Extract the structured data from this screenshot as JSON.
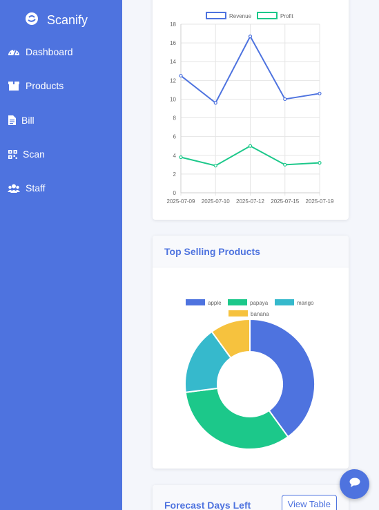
{
  "app": {
    "brand": "Scanify"
  },
  "sidebar": {
    "items": [
      {
        "label": "Dashboard",
        "icon": "gauge-icon"
      },
      {
        "label": "Products",
        "icon": "box-icon"
      },
      {
        "label": "Bill",
        "icon": "file-icon"
      },
      {
        "label": "Scan",
        "icon": "qr-icon"
      },
      {
        "label": "Staff",
        "icon": "users-icon"
      }
    ]
  },
  "colors": {
    "primary": "#4e73df",
    "revenue": "#4e73df",
    "profit": "#1cc88a",
    "mango": "#36b9cc",
    "banana": "#f6c23e"
  },
  "cards": {
    "top_selling": {
      "title": "Top Selling Products"
    },
    "forecast": {
      "title": "Forecast Days Left",
      "button": "View Table"
    }
  },
  "chart_data": [
    {
      "type": "line",
      "x": [
        "2025-07-09",
        "2025-07-10",
        "2025-07-12",
        "2025-07-15",
        "2025-07-19"
      ],
      "series": [
        {
          "name": "Revenue",
          "values": [
            12.5,
            9.6,
            16.7,
            10.0,
            10.6
          ],
          "color": "#4e73df"
        },
        {
          "name": "Profit",
          "values": [
            3.8,
            2.9,
            5.0,
            3.0,
            3.2
          ],
          "color": "#1cc88a"
        }
      ],
      "ylim": [
        0,
        18
      ],
      "yticks": [
        0,
        2,
        4,
        6,
        8,
        10,
        12,
        14,
        16,
        18
      ],
      "grid": true,
      "legend": "top"
    },
    {
      "type": "pie",
      "labels": [
        "apple",
        "papaya",
        "mango",
        "banana"
      ],
      "values": [
        40,
        33,
        17,
        10
      ],
      "colors": [
        "#4e73df",
        "#1cc88a",
        "#36b9cc",
        "#f6c23e"
      ],
      "legend": "top"
    }
  ]
}
